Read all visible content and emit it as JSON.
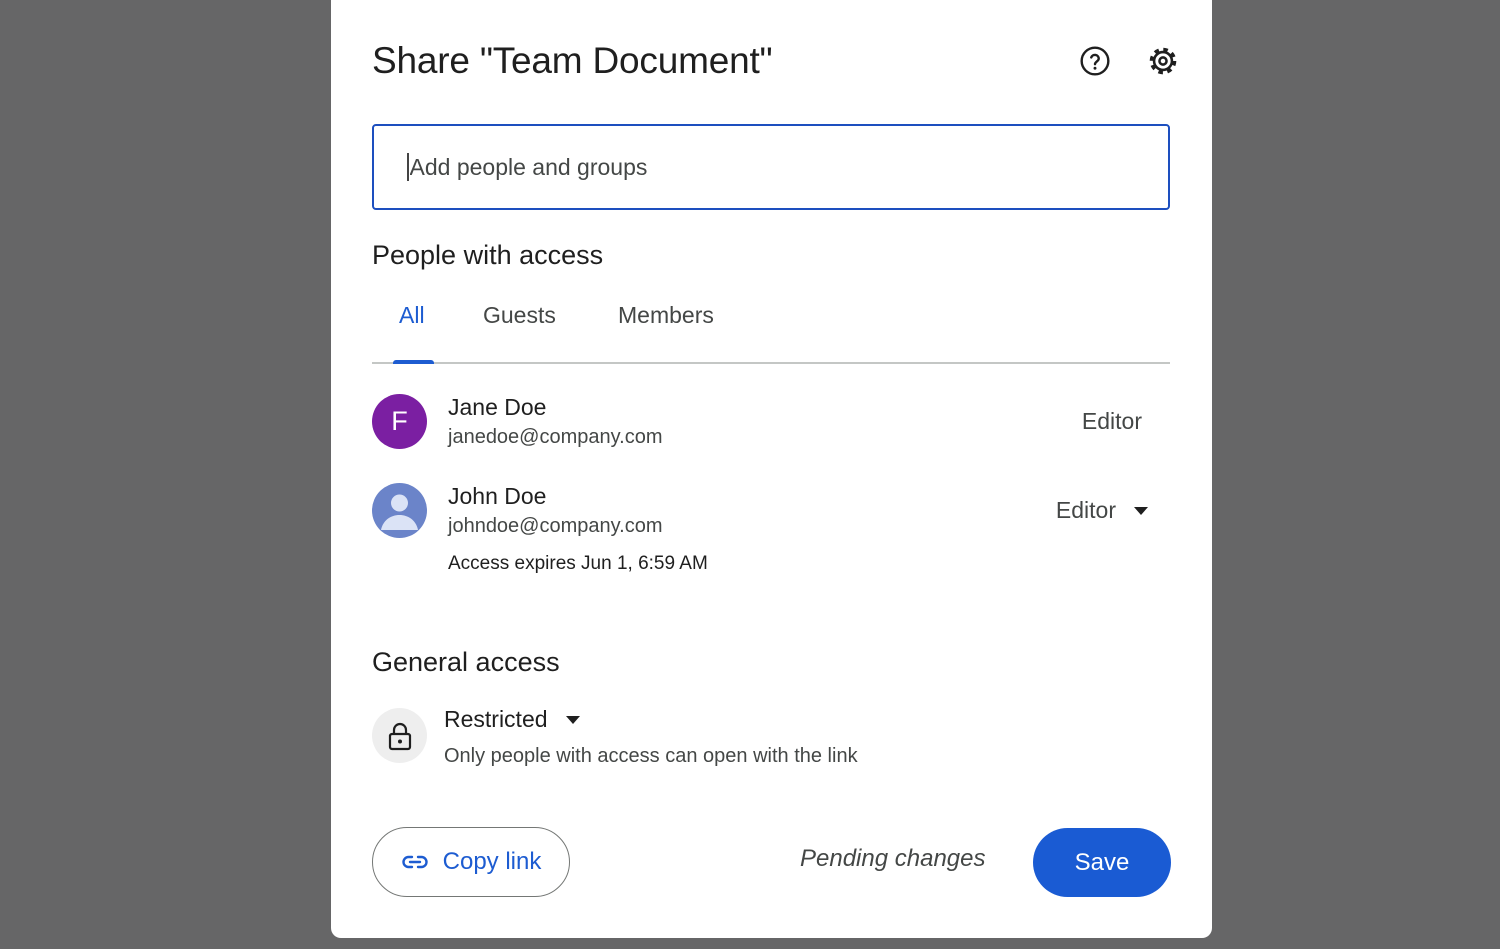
{
  "dialog": {
    "title": "Share \"Team Document\"",
    "icons": {
      "help": "help-circle-icon",
      "settings": "gear-icon"
    }
  },
  "add_people": {
    "placeholder": "Add people and groups",
    "value": ""
  },
  "people_section": {
    "heading": "People with access",
    "tabs": [
      {
        "label": "All",
        "active": true
      },
      {
        "label": "Guests",
        "active": false
      },
      {
        "label": "Members",
        "active": false
      }
    ],
    "people": [
      {
        "name": "Jane Doe",
        "email": "janedoe@company.com",
        "avatar_letter": "F",
        "avatar_color": "#7b1fa2",
        "role": "Editor"
      },
      {
        "name": "John Doe",
        "email": "johndoe@company.com",
        "avatar_icon": "person-avatar-icon",
        "avatar_color": "#6b84c9",
        "role": "Editor",
        "expiry": "Access expires Jun 1, 6:59 AM"
      }
    ]
  },
  "general_access": {
    "heading": "General access",
    "level": "Restricted",
    "description": "Only people with access can open with the link",
    "icon": "lock-icon"
  },
  "footer": {
    "copy_link_label": "Copy link",
    "copy_link_icon": "link-icon",
    "status": "Pending changes",
    "save_label": "Save"
  },
  "colors": {
    "accent": "#1d5cd1",
    "save_button": "#1a5bd3",
    "backdrop": "#666667"
  }
}
